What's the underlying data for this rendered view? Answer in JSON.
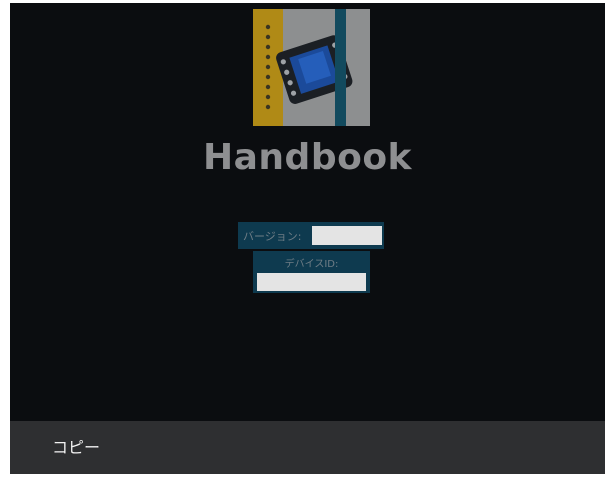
{
  "app": {
    "title": "Handbook",
    "logo_icon": "film-strip-icon"
  },
  "info": {
    "version_label": "バージョン:",
    "version_value": "",
    "device_id_label": "デバイスID:",
    "device_id_value": ""
  },
  "bottom_bar": {
    "copy_label": "コピー"
  },
  "colors": {
    "background": "#0b0d10",
    "field_box": "#0e3a4f",
    "bottom_bar": "#2e2f31",
    "title": "#8e8f91"
  }
}
